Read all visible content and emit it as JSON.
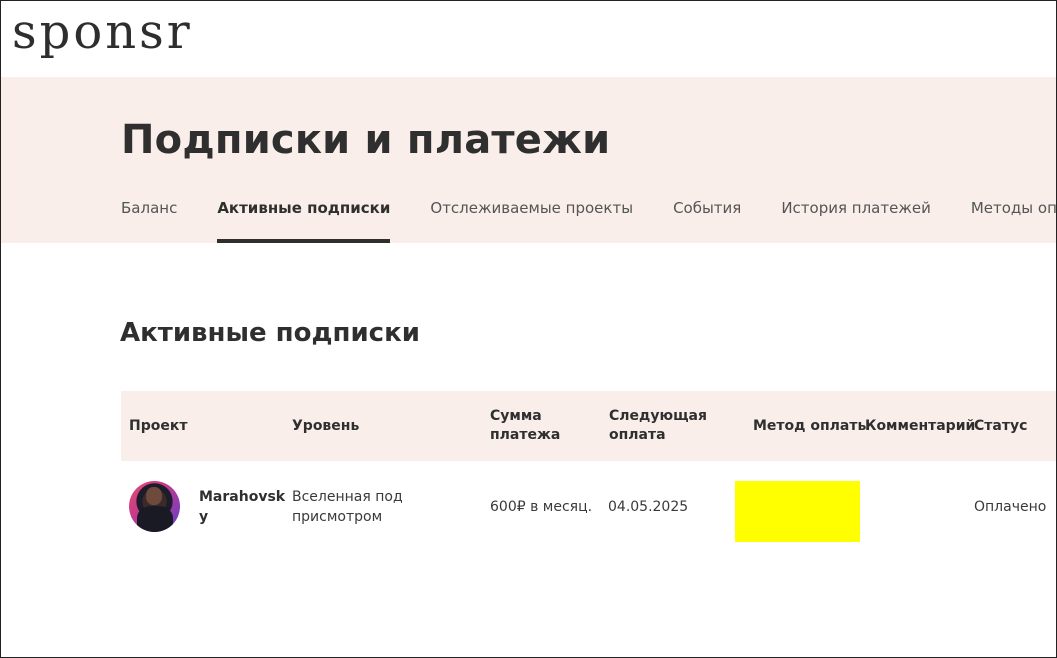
{
  "brand": {
    "logo_text": "sponsr"
  },
  "page": {
    "title": "Подписки и платежи",
    "tabs": [
      {
        "label": "Баланс",
        "active": false
      },
      {
        "label": "Активные подписки",
        "active": true
      },
      {
        "label": "Отслеживаемые проекты",
        "active": false
      },
      {
        "label": "События",
        "active": false
      },
      {
        "label": "История платежей",
        "active": false
      },
      {
        "label": "Методы оплаты",
        "active": false
      }
    ]
  },
  "section": {
    "title": "Активные подписки"
  },
  "table": {
    "headers": {
      "project": "Проект",
      "level": "Уровень",
      "amount_line1": "Сумма",
      "amount_line2": "платежа",
      "next_line1": "Следующая",
      "next_line2": "оплата",
      "method": "Метод оплаты",
      "comment": "Комментарий",
      "status": "Статус"
    },
    "rows": [
      {
        "project_line1": "Marahovsk",
        "project_line2": "y",
        "level_line1": "Вселенная под",
        "level_line2": "присмотром",
        "amount": "600₽ в месяц.",
        "next_payment": "04.05.2025",
        "payment_method_color": "#ffff00",
        "comment": "",
        "status": "Оплачено"
      }
    ]
  },
  "colors": {
    "accent_bg": "#f9eeea",
    "text": "#2f2f2f",
    "redaction": "#ffff00"
  }
}
